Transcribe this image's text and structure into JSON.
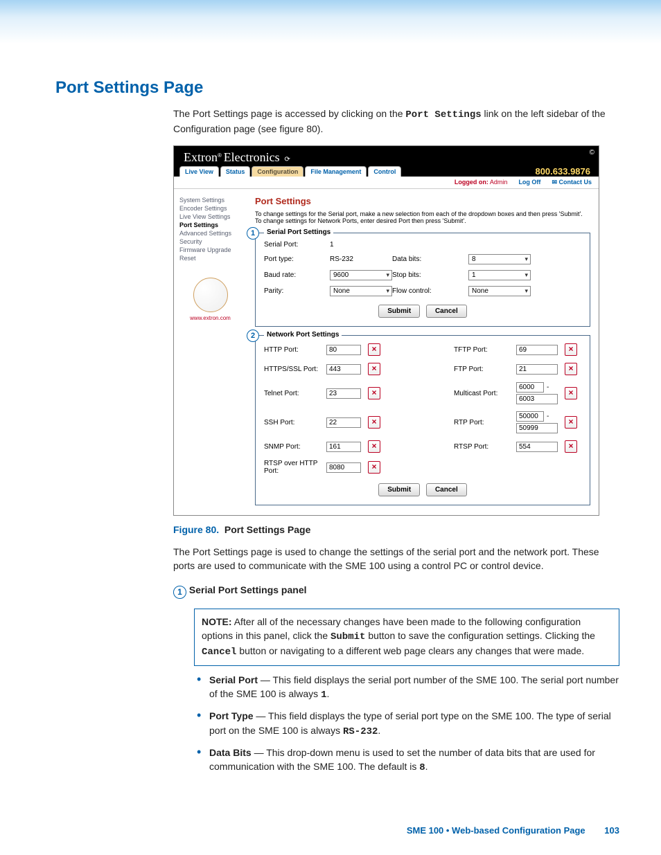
{
  "page": {
    "title": "Port Settings Page",
    "intro_before": "The Port Settings page is accessed by clicking on the ",
    "intro_link": "Port Settings",
    "intro_after": " link on the left sidebar of the Configuration page (see figure 80)."
  },
  "caption": {
    "label": "Figure 80.",
    "text": "Port Settings Page"
  },
  "body": {
    "usage": "The Port Settings page is used to change the settings of the serial port and the network port. These ports are used to communicate with the SME 100 using a control PC or control device.",
    "sect1_num": "1",
    "sect1_title": "Serial Port Settings panel"
  },
  "note": {
    "label": "NOTE:",
    "t1": "After all of the necessary changes have been made to the following configuration options in this panel, click the ",
    "btn1": "Submit",
    "t2": " button to save the configuration settings. Clicking the ",
    "btn2": "Cancel",
    "t3": " button or navigating to a different web page clears any changes that were made."
  },
  "defs": {
    "sp_t": "Serial Port",
    "sp_b1": " — This field displays the serial port number of the SME 100. The serial port number of the SME 100 is always ",
    "sp_v": "1",
    "sp_b2": ".",
    "pt_t": "Port Type",
    "pt_b1": " — This field displays the type of serial port type on the SME 100. The type of serial port on the SME 100 is always ",
    "pt_v": "RS-232",
    "pt_b2": ".",
    "db_t": "Data Bits",
    "db_b1": " — This drop-down menu is used to set the number of data bits that are used for communication with the SME 100. The default is ",
    "db_v": "8",
    "db_b2": "."
  },
  "footer": {
    "text": "SME 100 • Web-based Configuration Page",
    "page": "103"
  },
  "shot": {
    "brand": {
      "name": "Extron",
      "sub": "Electronics"
    },
    "tabs": [
      "Live View",
      "Status",
      "Configuration",
      "File Management",
      "Control"
    ],
    "selected_tab": 2,
    "phone": "800.633.9876",
    "infobar": {
      "logged_label": "Logged on:",
      "user": "Admin",
      "logoff": "Log Off",
      "contact": "Contact Us"
    },
    "sidebar": [
      "System Settings",
      "Encoder Settings",
      "Live View Settings",
      "Port Settings",
      "Advanced Settings",
      "Security",
      "Firmware Upgrade",
      "Reset"
    ],
    "sidebar_active": 3,
    "logo_url": "www.extron.com",
    "content": {
      "heading": "Port Settings",
      "desc": "To change settings for the Serial port, make a new selection from each of the dropdown boxes and then press 'Submit'. To change settings for Network Ports, enter desired Port then press 'Submit'."
    },
    "serial": {
      "legend": "Serial Port Settings",
      "rows": {
        "serial_port_l": "Serial Port:",
        "serial_port_v": "1",
        "port_type_l": "Port type:",
        "port_type_v": "RS-232",
        "data_bits_l": "Data bits:",
        "data_bits_v": "8",
        "baud_l": "Baud rate:",
        "baud_v": "9600",
        "stop_l": "Stop bits:",
        "stop_v": "1",
        "parity_l": "Parity:",
        "parity_v": "None",
        "flow_l": "Flow control:",
        "flow_v": "None"
      },
      "submit": "Submit",
      "cancel": "Cancel"
    },
    "network": {
      "legend": "Network Port Settings",
      "ports": {
        "http_l": "HTTP Port:",
        "http_v": "80",
        "https_l": "HTTPS/SSL Port:",
        "https_v": "443",
        "telnet_l": "Telnet Port:",
        "telnet_v": "23",
        "ssh_l": "SSH Port:",
        "ssh_v": "22",
        "snmp_l": "SNMP Port:",
        "snmp_v": "161",
        "rtspoh_l": "RTSP over HTTP Port:",
        "rtspoh_v": "8080",
        "tftp_l": "TFTP Port:",
        "tftp_v": "69",
        "ftp_l": "FTP Port:",
        "ftp_v": "21",
        "mcast_l": "Multicast Port:",
        "mcast_lo": "6000",
        "mcast_hi": "6003",
        "rtp_l": "RTP Port:",
        "rtp_lo": "50000",
        "rtp_hi": "50999",
        "rtsp_l": "RTSP Port:",
        "rtsp_v": "554"
      },
      "submit": "Submit",
      "cancel": "Cancel"
    }
  },
  "chart_data": {
    "type": "table",
    "title": "Port Settings Page — values shown",
    "serial_port_settings": {
      "Serial Port": "1",
      "Port type": "RS-232",
      "Baud rate": "9600",
      "Parity": "None",
      "Data bits": "8",
      "Stop bits": "1",
      "Flow control": "None"
    },
    "network_port_settings": {
      "HTTP Port": 80,
      "HTTPS/SSL Port": 443,
      "Telnet Port": 23,
      "SSH Port": 22,
      "SNMP Port": 161,
      "RTSP over HTTP Port": 8080,
      "TFTP Port": 69,
      "FTP Port": 21,
      "Multicast Port": [
        6000,
        6003
      ],
      "RTP Port": [
        50000,
        50999
      ],
      "RTSP Port": 554
    }
  }
}
